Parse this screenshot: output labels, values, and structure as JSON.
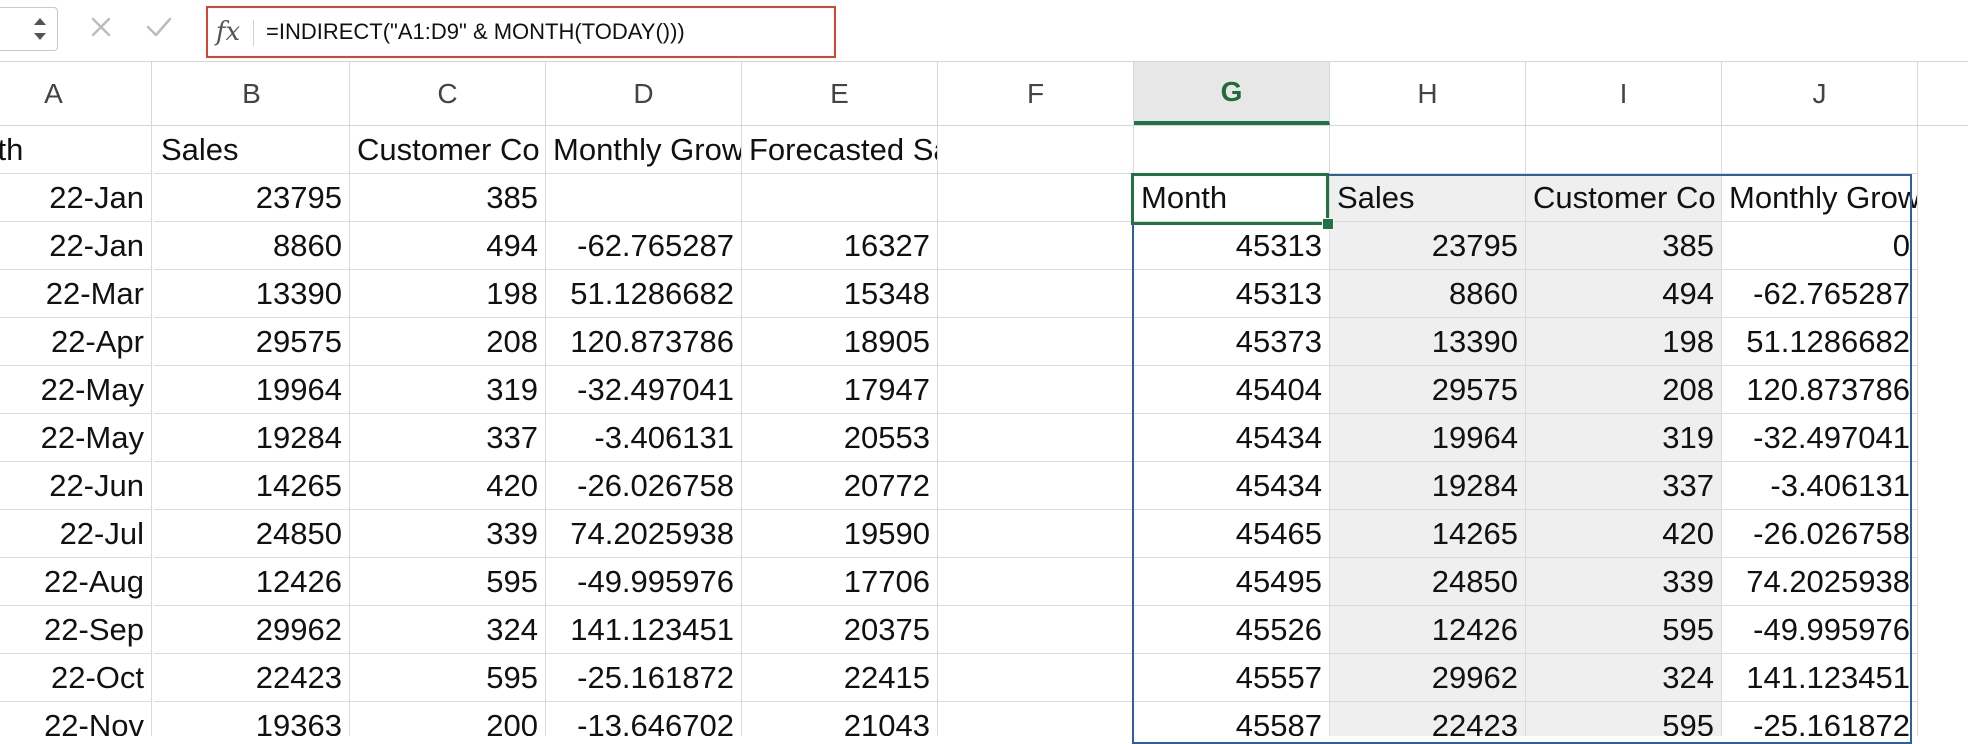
{
  "formula_bar": {
    "fx_label": "fx",
    "formula": "=INDIRECT(\"A1:D9\" & MONTH(TODAY()))"
  },
  "columns": [
    "A",
    "B",
    "C",
    "D",
    "E",
    "F",
    "G",
    "H",
    "I",
    "J"
  ],
  "selected_column": "G",
  "headers_left": [
    "onth",
    "Sales",
    "Customer Co",
    "Monthly Grow",
    "Forecasted Sales"
  ],
  "headers_right": [
    "Month",
    "Sales",
    "Customer Co",
    "Monthly Growth"
  ],
  "left_table": [
    [
      "22-Jan",
      "23795",
      "385",
      "",
      ""
    ],
    [
      "22-Jan",
      "8860",
      "494",
      "-62.765287",
      "16327"
    ],
    [
      "22-Mar",
      "13390",
      "198",
      "51.1286682",
      "15348"
    ],
    [
      "22-Apr",
      "29575",
      "208",
      "120.873786",
      "18905"
    ],
    [
      "22-May",
      "19964",
      "319",
      "-32.497041",
      "17947"
    ],
    [
      "22-May",
      "19284",
      "337",
      "-3.406131",
      "20553"
    ],
    [
      "22-Jun",
      "14265",
      "420",
      "-26.026758",
      "20772"
    ],
    [
      "22-Jul",
      "24850",
      "339",
      "74.2025938",
      "19590"
    ],
    [
      "22-Aug",
      "12426",
      "595",
      "-49.995976",
      "17706"
    ],
    [
      "22-Sep",
      "29962",
      "324",
      "141.123451",
      "20375"
    ],
    [
      "22-Oct",
      "22423",
      "595",
      "-25.161872",
      "22415"
    ],
    [
      "22-Nov",
      "19363",
      "200",
      "-13.646702",
      "21043"
    ]
  ],
  "right_table": [
    [
      "45313",
      "23795",
      "385",
      "0"
    ],
    [
      "45313",
      "8860",
      "494",
      "-62.765287"
    ],
    [
      "45373",
      "13390",
      "198",
      "51.1286682"
    ],
    [
      "45404",
      "29575",
      "208",
      "120.873786"
    ],
    [
      "45434",
      "19964",
      "319",
      "-32.497041"
    ],
    [
      "45434",
      "19284",
      "337",
      "-3.406131"
    ],
    [
      "45465",
      "14265",
      "420",
      "-26.026758"
    ],
    [
      "45495",
      "24850",
      "339",
      "74.2025938"
    ],
    [
      "45526",
      "12426",
      "595",
      "-49.995976"
    ],
    [
      "45557",
      "29962",
      "324",
      "141.123451"
    ],
    [
      "45587",
      "22423",
      "595",
      "-25.161872"
    ]
  ],
  "colors": {
    "formula_highlight": "#d9432f",
    "active_cell": "#217346",
    "selection": "#2f5f9e"
  }
}
